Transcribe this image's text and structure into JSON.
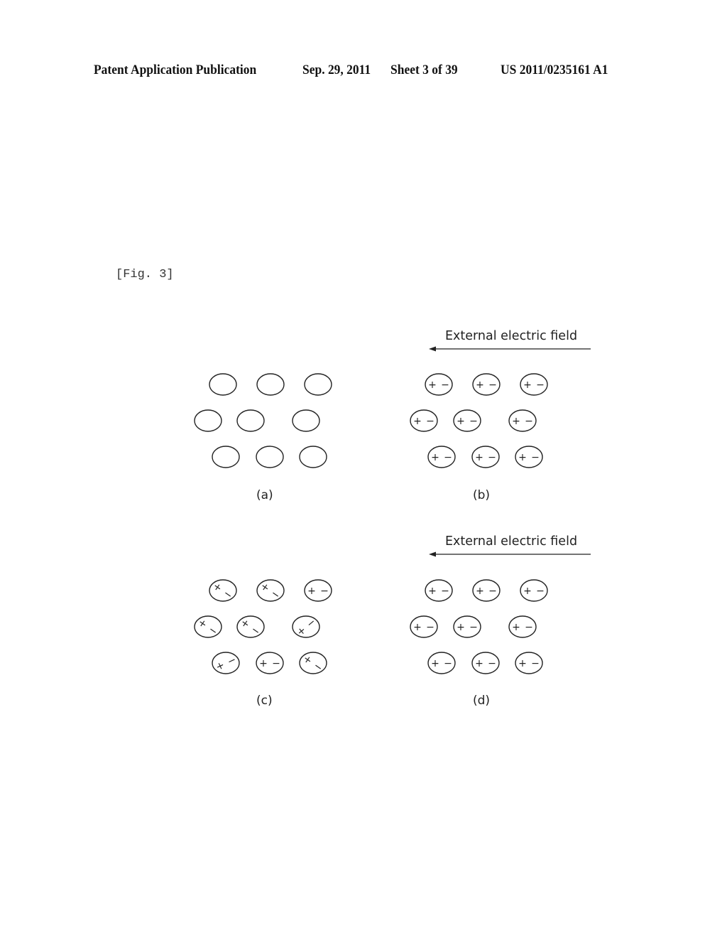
{
  "header": {
    "publication": "Patent Application Publication",
    "date": "Sep. 29, 2011",
    "sheet": "Sheet 3 of 39",
    "number": "US 2011/0235161 A1"
  },
  "figure": {
    "label": "[Fig. 3]",
    "panels": [
      {
        "id": "a",
        "caption": "(a)",
        "field_label": null,
        "state": "unpolarized"
      },
      {
        "id": "b",
        "caption": "(b)",
        "field_label": "External electric field",
        "state": "aligned"
      },
      {
        "id": "c",
        "caption": "(c)",
        "field_label": null,
        "state": "random"
      },
      {
        "id": "d",
        "caption": "(d)",
        "field_label": "External electric field",
        "state": "aligned"
      }
    ],
    "charge_symbols": {
      "positive": "+",
      "negative": "−"
    },
    "field_direction": "left"
  }
}
